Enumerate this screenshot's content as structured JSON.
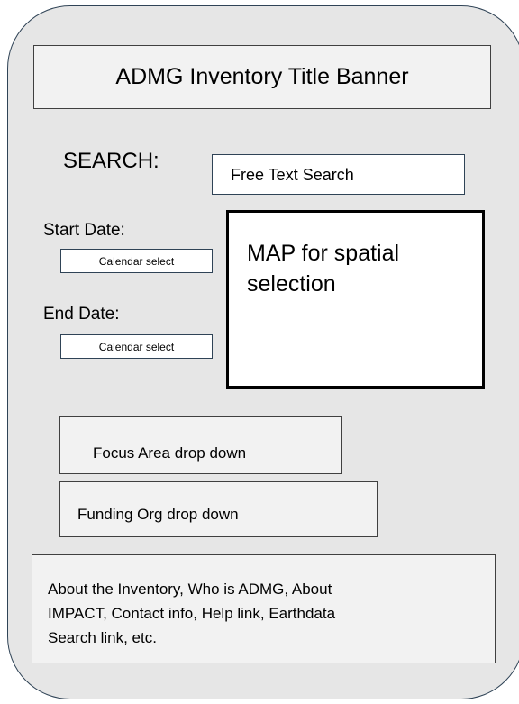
{
  "banner": {
    "title": "ADMG Inventory Title Banner"
  },
  "search": {
    "label": "SEARCH:",
    "input_value": "Free Text Search"
  },
  "dates": {
    "start_label": "Start Date:",
    "start_select": "Calendar select",
    "end_label": "End Date:",
    "end_select": "Calendar select"
  },
  "map": {
    "line1": "MAP for spatial",
    "line2": "selection"
  },
  "dropdowns": {
    "focus_area": "Focus Area drop down",
    "funding_org": "Funding Org drop down"
  },
  "footer": {
    "line1": "About the Inventory, Who is ADMG, About",
    "line2": "IMPACT, Contact info, Help link, Earthdata",
    "line3": "Search link, etc."
  },
  "colors": {
    "panel_background": "#e6e6e6",
    "box_background": "#f2f2f2",
    "border": "#2f4356"
  }
}
